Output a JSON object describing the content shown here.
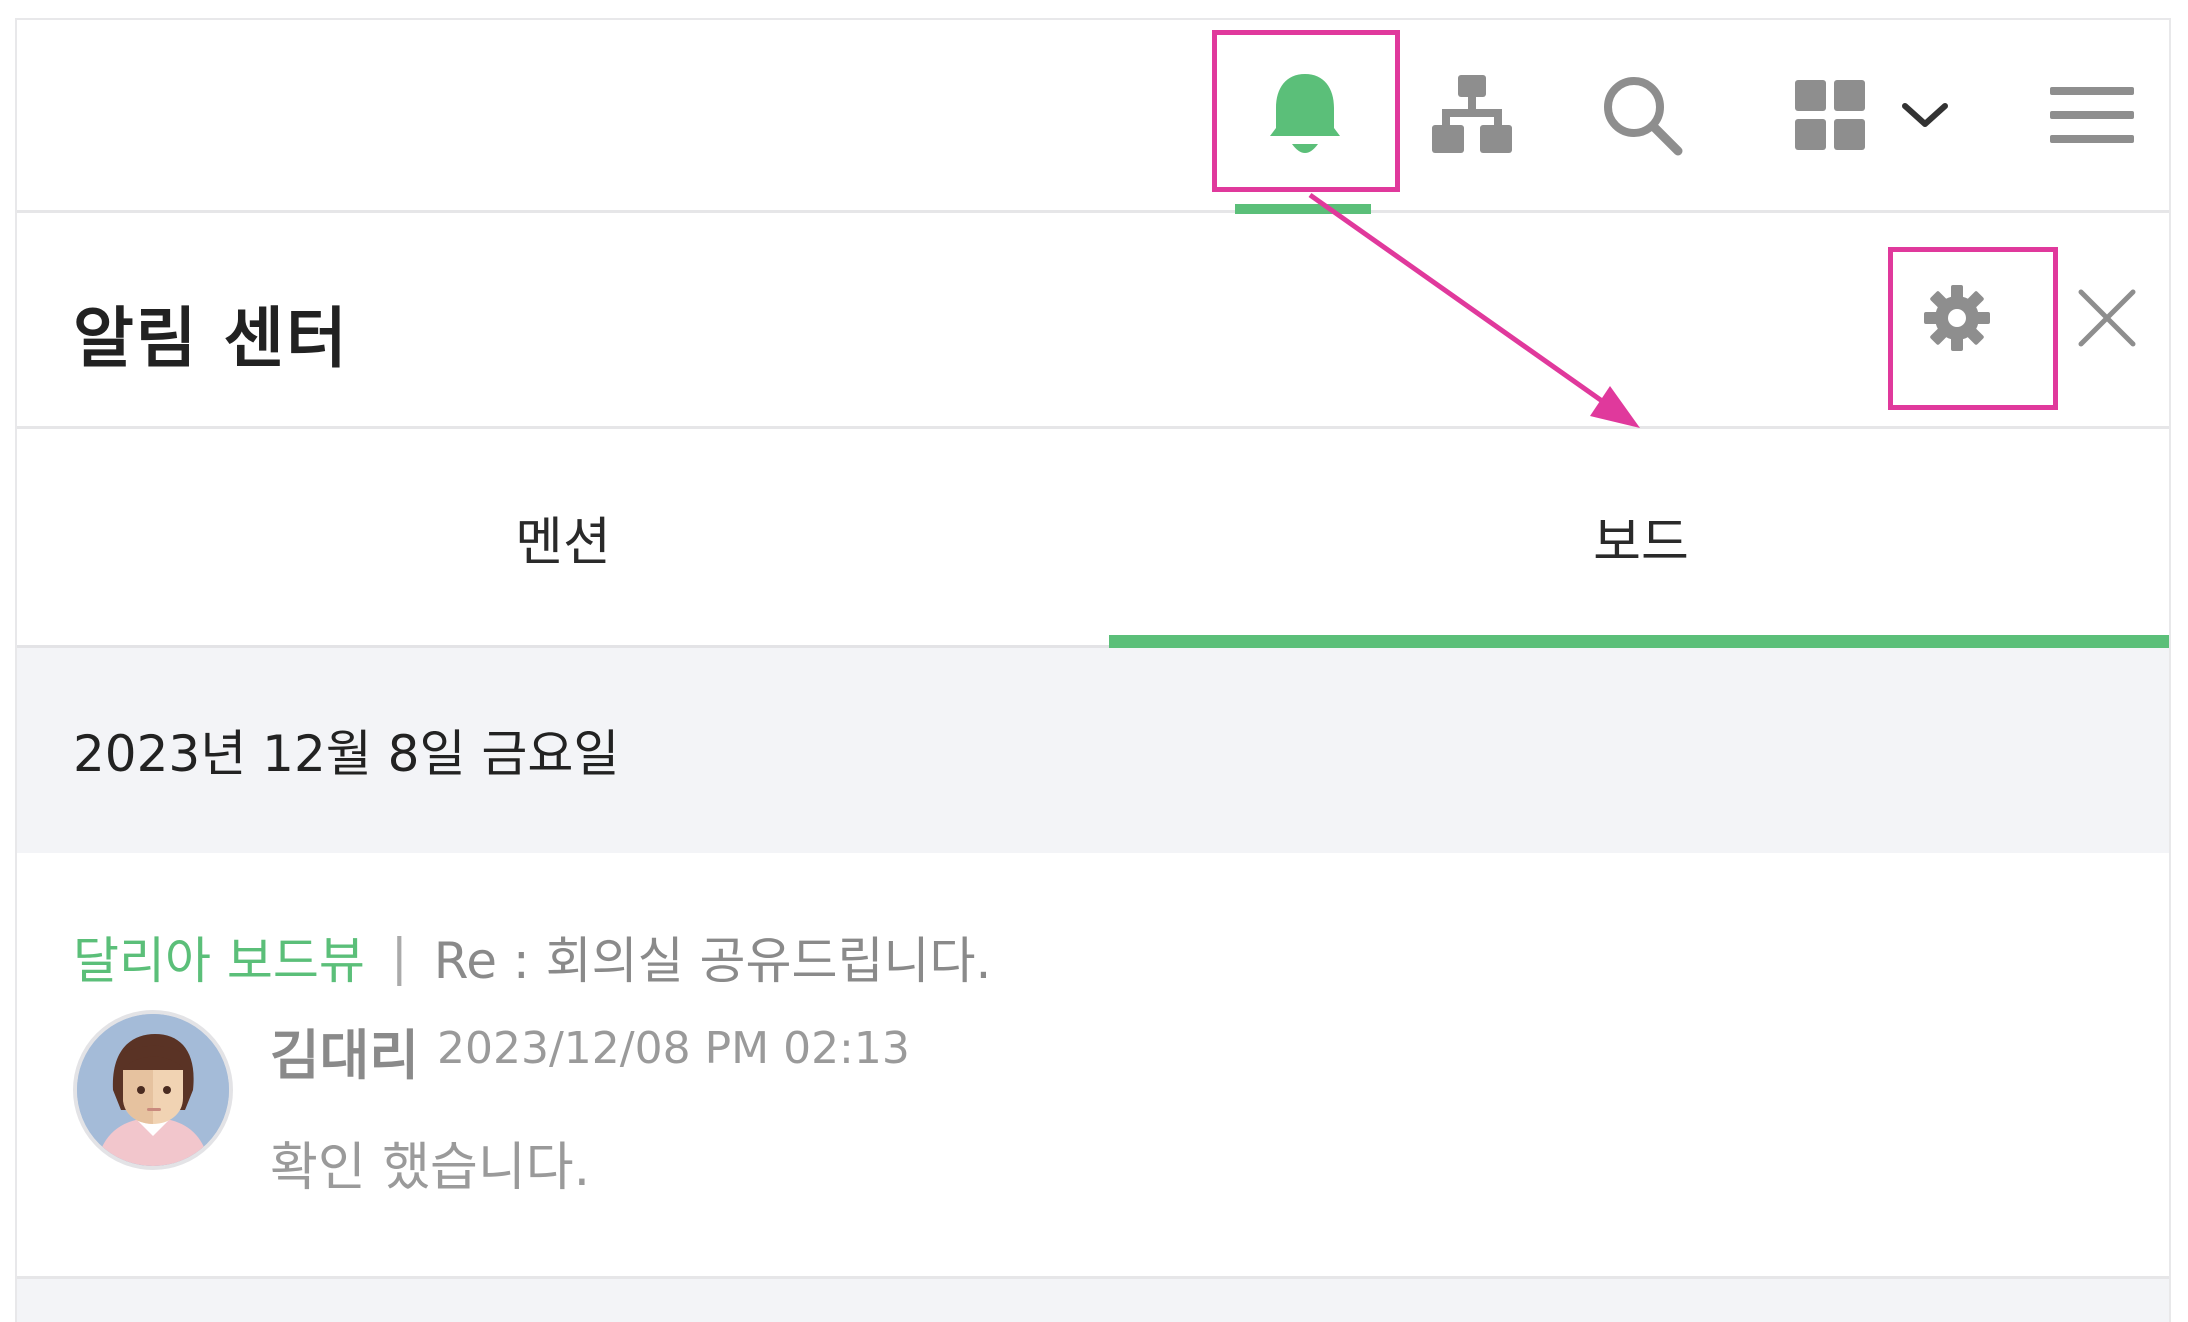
{
  "toolbar": {
    "icons": [
      "bell-icon",
      "org-chart-icon",
      "search-icon",
      "apps-grid-icon",
      "chevron-down-icon",
      "menu-icon"
    ],
    "active_icon": "bell-icon"
  },
  "panel": {
    "title": "알림 센터",
    "settings_icon": "gear-icon",
    "close_icon": "close-icon"
  },
  "tabs": [
    {
      "label": "멘션",
      "active": false
    },
    {
      "label": "보드",
      "active": true
    }
  ],
  "groups": [
    {
      "date": "2023년 12월 8일 금요일",
      "items": [
        {
          "board": "달리아 보드뷰",
          "separator": "|",
          "subject": "Re : 회의실 공유드립니다.",
          "author": "김대리",
          "time": "2023/12/08 PM 02:13",
          "body": "확인 했습니다."
        }
      ]
    }
  ],
  "colors": {
    "accent": "#5bbf79",
    "icon_gray": "#8e8e8e",
    "highlight": "#e0399c",
    "group_bg": "#f3f4f7"
  }
}
